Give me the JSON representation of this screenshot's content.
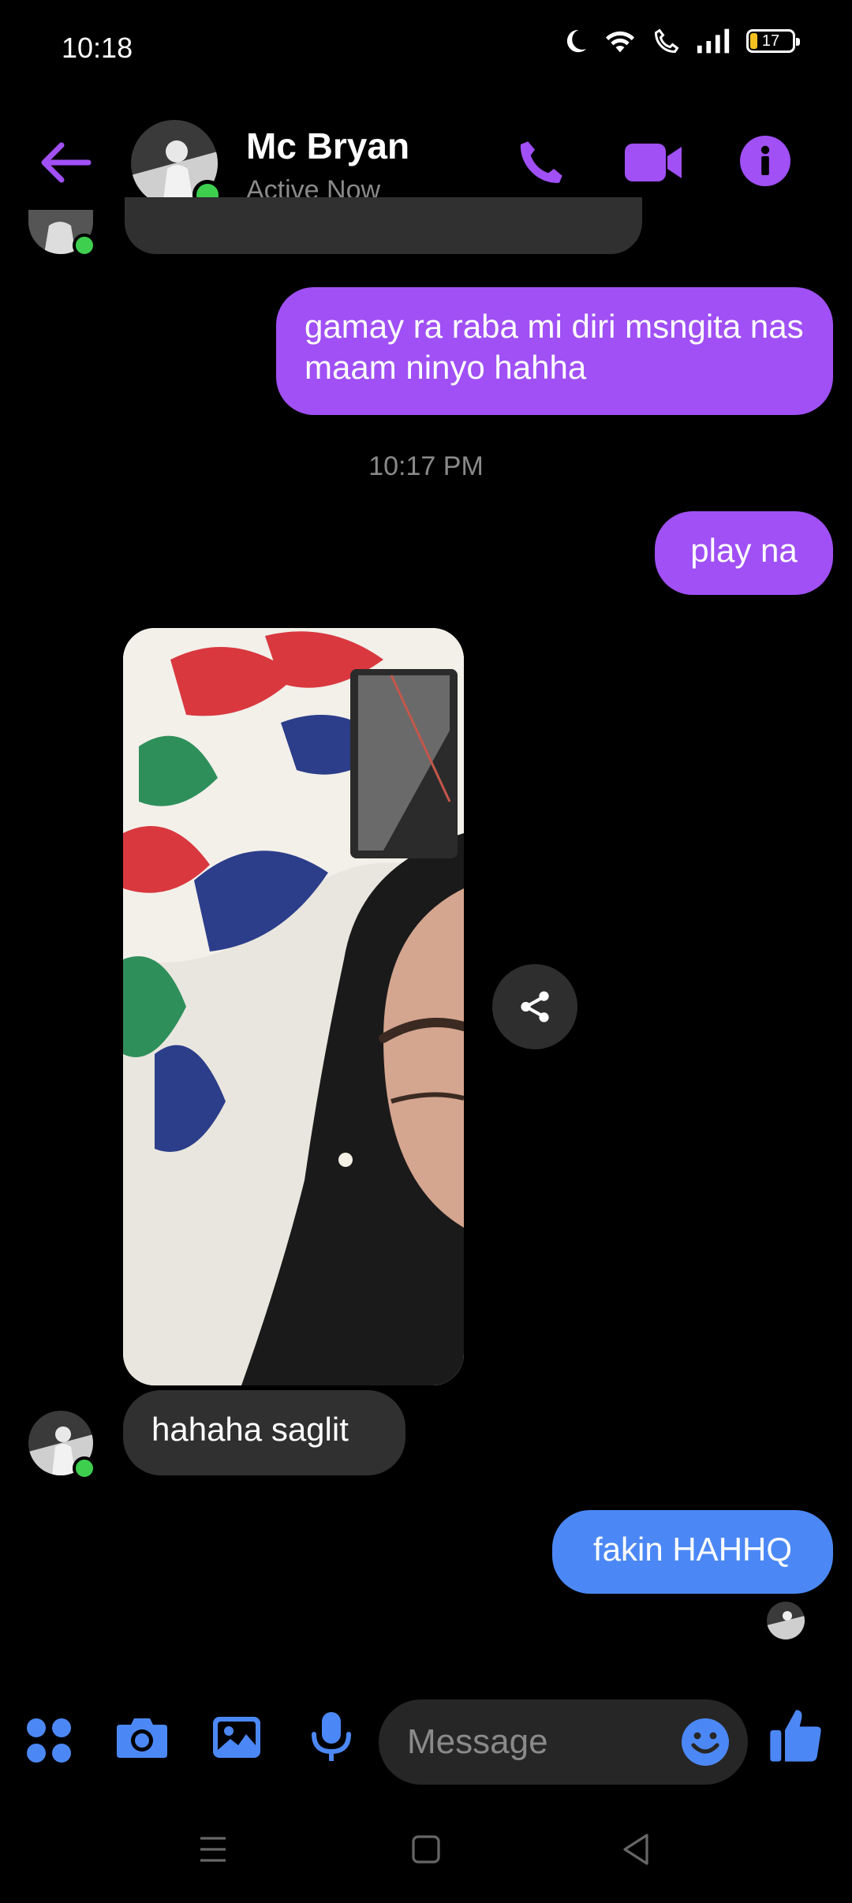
{
  "status_bar": {
    "time": "10:18",
    "battery_level": "17",
    "battery_fraction": 0.17
  },
  "header": {
    "contact_name": "Mc Bryan",
    "contact_status": "Active Now",
    "accent_color": "#a050f5"
  },
  "messages": [
    {
      "sender": "me",
      "text": "gamay ra raba mi diri msngita nas maam ninyo hahha",
      "color": "#a050f5"
    },
    {
      "type": "timestamp",
      "text": "10:17 PM"
    },
    {
      "sender": "me",
      "text": "play na",
      "color": "#a050f5"
    },
    {
      "sender": "them",
      "type": "image"
    },
    {
      "sender": "them",
      "text": "hahaha saglit",
      "color": "#303030"
    },
    {
      "sender": "me",
      "text": "fakin HAHHQ",
      "color": "#4c88f5"
    }
  ],
  "composer": {
    "placeholder": "Message",
    "icon_color": "#4c88f5"
  },
  "icons": {
    "back": "arrow-left-icon",
    "call": "phone-icon",
    "video": "video-camera-icon",
    "info": "info-icon",
    "share": "share-icon",
    "menu": "four-dots-icon",
    "camera": "camera-icon",
    "gallery": "image-icon",
    "mic": "microphone-icon",
    "emoji": "smiley-icon",
    "like": "thumbs-up-icon"
  }
}
